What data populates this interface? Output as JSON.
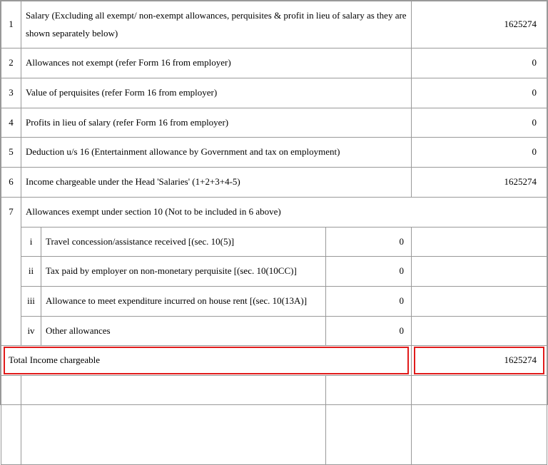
{
  "rows": {
    "r1": {
      "num": "1",
      "desc": "Salary (Excluding all exempt/ non-exempt allowances, perquisites & profit in lieu of salary as they are shown separately below)",
      "value": "1625274"
    },
    "r2": {
      "num": "2",
      "desc": "Allowances not exempt (refer Form 16 from employer)",
      "value": "0"
    },
    "r3": {
      "num": "3",
      "desc": "Value of perquisites (refer Form 16 from employer)",
      "value": "0"
    },
    "r4": {
      "num": "4",
      "desc": "Profits in lieu of salary (refer Form 16 from employer)",
      "value": "0"
    },
    "r5": {
      "num": "5",
      "desc": "Deduction u/s 16 (Entertainment allowance by Government and tax on employment)",
      "value": "0"
    },
    "r6": {
      "num": "6",
      "desc": "Income chargeable under the Head 'Salaries' (1+2+3+4-5)",
      "value": "1625274"
    },
    "r7": {
      "num": "7",
      "desc": "Allowances exempt under section 10 (Not to be included in 6 above)"
    }
  },
  "sub": {
    "i": {
      "num": "i",
      "desc": "Travel concession/assistance received [(sec. 10(5)]",
      "value": "0"
    },
    "ii": {
      "num": "ii",
      "desc": "Tax paid by employer on non-monetary perquisite [(sec. 10(10CC)]",
      "value": "0"
    },
    "iii": {
      "num": "iii",
      "desc": "Allowance to meet expenditure incurred on house rent [(sec. 10(13A)]",
      "value": "0"
    },
    "iv": {
      "num": "iv",
      "desc": "Other allowances",
      "value": "0"
    }
  },
  "total": {
    "label": "Total Income chargeable",
    "value": "1625274"
  }
}
